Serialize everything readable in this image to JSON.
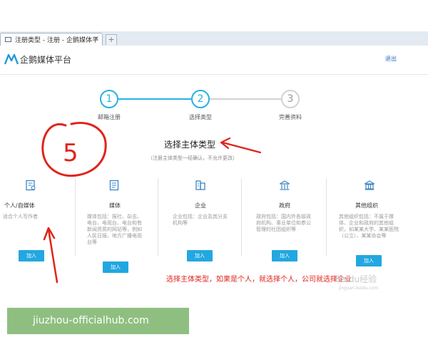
{
  "browser": {
    "tab_title": "注册类型 - 注册 - 企鹅媒体平",
    "tab_close": "×",
    "new_tab": "+"
  },
  "header": {
    "logo_text": "企鹅媒体平台",
    "logout": "退出"
  },
  "steps": [
    {
      "number": "1",
      "label": "邮箱注册",
      "state": "active"
    },
    {
      "number": "2",
      "label": "选择类型",
      "state": "active"
    },
    {
      "number": "3",
      "label": "完善资料",
      "state": "inactive"
    }
  ],
  "section": {
    "title": "选择主体类型",
    "subtitle": "（注册主体类型一经确认，不允许更改）"
  },
  "categories": [
    {
      "icon": "id-card-icon",
      "title": "个人/自媒体",
      "desc": "适合个人写作者",
      "button": "加入"
    },
    {
      "icon": "media-document-icon",
      "title": "媒体",
      "desc": "媒体包括：报社、杂志、电台、电视台、电台和有新闻资质的网站等，例如人民日报、地方广播电视台等",
      "button": "加入"
    },
    {
      "icon": "building-icon",
      "title": "企业",
      "desc": "企业包括：企业及其分支机构等",
      "button": "加入"
    },
    {
      "icon": "government-icon",
      "title": "政府",
      "desc": "政府包括：国内外各级政府机构、事业单位和参公管理的社团组织等",
      "button": "加入"
    },
    {
      "icon": "institution-icon",
      "title": "其他组织",
      "desc": "其他组织包括：不属于媒体、企业和政府的其他组织，如某某大学、某某医院（公立）、某某协会等",
      "button": "加入"
    }
  ],
  "annotation": {
    "number": "5",
    "note": "选择主体类型，如果是个人，就选择个人，公司就选择企业"
  },
  "watermark": {
    "text": "Baidu经验",
    "url": "jingyan.baidu.com"
  },
  "banner": {
    "text": "jiuzhou-officialhub.com"
  },
  "colors": {
    "accent": "#22a7e0",
    "annotation_red": "#e0231b",
    "banner_green": "#8fbf80"
  }
}
